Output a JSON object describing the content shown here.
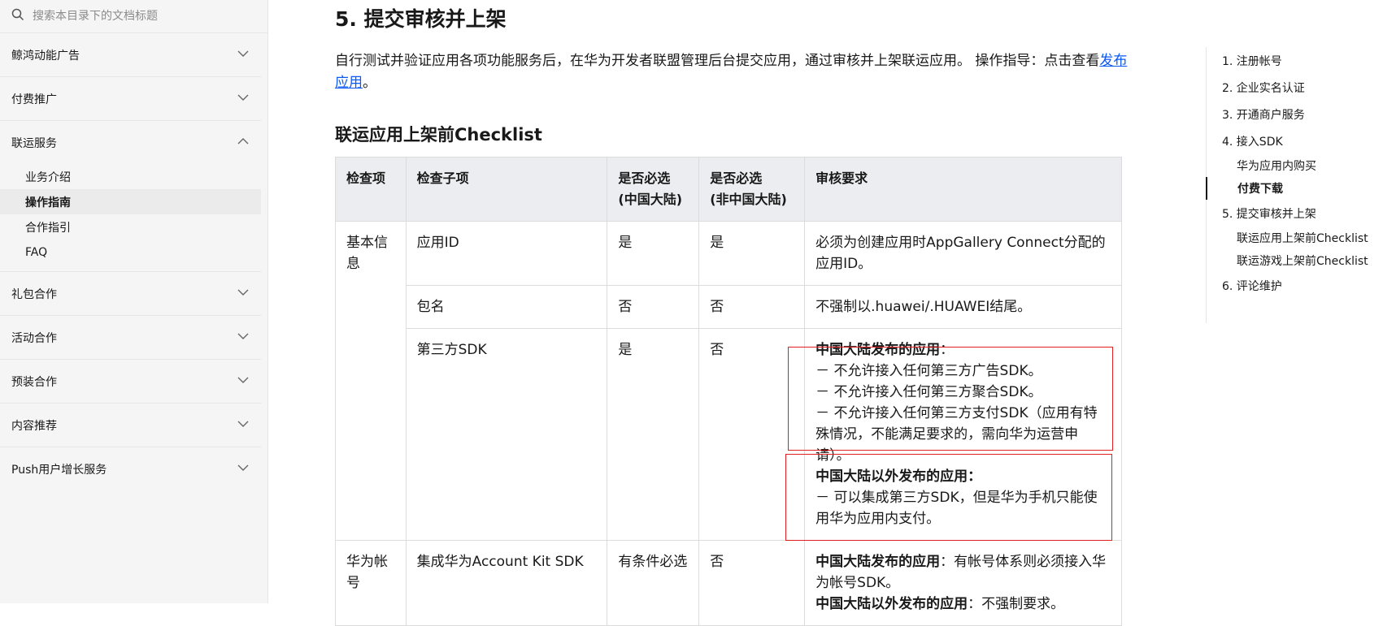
{
  "search": {
    "placeholder": "搜索本目录下的文档标题"
  },
  "sidebar": {
    "groups": [
      {
        "label": "鲸鸿动能广告",
        "expanded": false
      },
      {
        "label": "付费推广",
        "expanded": false
      },
      {
        "label": "联运服务",
        "expanded": true,
        "items": [
          "业务介绍",
          "操作指南",
          "合作指引",
          "FAQ"
        ],
        "active_item": "操作指南"
      },
      {
        "label": "礼包合作",
        "expanded": false
      },
      {
        "label": "活动合作",
        "expanded": false
      },
      {
        "label": "预装合作",
        "expanded": false
      },
      {
        "label": "内容推荐",
        "expanded": false
      },
      {
        "label": "Push用户增长服务",
        "expanded": false
      }
    ]
  },
  "main": {
    "title": "5. 提交审核并上架",
    "intro_text": "自行测试并验证应用各项功能服务后，在华为开发者联盟管理后台提交应用，通过审核并上架联运应用。 操作指导：点击查看",
    "intro_link": "发布应用",
    "intro_end": "。",
    "checklist_title": "联运应用上架前Checklist",
    "table": {
      "headers": [
        "检查项",
        "检查子项",
        "是否必选\n(中国大陆)",
        "是否必选\n(非中国大陆)",
        "审核要求"
      ],
      "rows": [
        {
          "item": "基本信息",
          "sub": "应用ID",
          "cn": "是",
          "non_cn": "是",
          "req": "必须为创建应用时AppGallery Connect分配的应用ID。"
        },
        {
          "sub": "包名",
          "cn": "否",
          "non_cn": "否",
          "req": "不强制以.huawei/.HUAWEI结尾。"
        },
        {
          "sub": "第三方SDK",
          "cn": "是",
          "non_cn": "否",
          "req_cn_title": "中国大陆发布的应用",
          "req_cn_colon": "：",
          "req_cn_lines": [
            "－ 不允许接入任何第三方广告SDK。",
            "－ 不允许接入任何第三方聚合SDK。",
            "－ 不允许接入任何第三方支付SDK（应用有特殊情况，不能满足要求的，需向华为运营申请）。"
          ],
          "req_non_title": "中国大陆以外发布的应用：",
          "req_non_lines": [
            "－ 可以集成第三方SDK，但是华为手机只能使用华为应用内支付。"
          ]
        },
        {
          "item": "华为帐号",
          "sub": "集成华为Account Kit SDK",
          "cn": "有条件必选",
          "non_cn": "否",
          "req_cn_title": "中国大陆发布的应用",
          "req_cn_text": "：有帐号体系则必须接入华为帐号SDK。",
          "req_non_title": "中国大陆以外发布的应用",
          "req_non_text": "：不强制要求。"
        }
      ]
    }
  },
  "toc": {
    "items": [
      {
        "label": "1. 注册帐号"
      },
      {
        "label": "2. 企业实名认证"
      },
      {
        "label": "3. 开通商户服务"
      },
      {
        "label": "4. 接入SDK"
      },
      {
        "label": "华为应用内购买",
        "sub": true
      },
      {
        "label": "付费下载",
        "sub": true,
        "active": true
      },
      {
        "label": "5. 提交审核并上架"
      },
      {
        "label": "联运应用上架前Checklist",
        "sub": true
      },
      {
        "label": "联运游戏上架前Checklist",
        "sub": true
      },
      {
        "label": "6. 评论维护"
      }
    ]
  },
  "colors": {
    "link": "#0a59f7",
    "highlight_box": "#e02020",
    "table_header_bg": "#ebedf0"
  }
}
